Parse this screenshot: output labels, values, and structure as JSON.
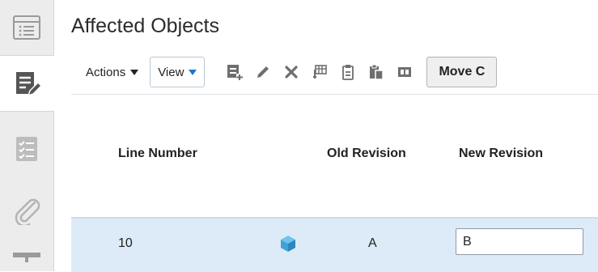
{
  "rail": {
    "items": [
      {
        "icon": "list-icon",
        "active": false
      },
      {
        "icon": "edit-document-icon",
        "active": true
      },
      {
        "icon": "checklist-icon",
        "active": false
      },
      {
        "icon": "paperclip-icon",
        "active": false
      },
      {
        "icon": "more-icon",
        "active": false
      }
    ]
  },
  "main": {
    "title": "Affected Objects",
    "toolbar": {
      "actions_label": "Actions",
      "view_label": "View",
      "icons": [
        "add-row-icon",
        "edit-pencil-icon",
        "delete-icon",
        "freeze-columns-icon",
        "copy-icon",
        "paste-icon",
        "detach-icon"
      ],
      "move_label": "Move C"
    },
    "table": {
      "columns": [
        "Line Number",
        "Old Revision",
        "New Revision"
      ],
      "rows": [
        {
          "line_number": "10",
          "item_icon": "item-cube-icon",
          "old_revision": "A",
          "new_revision": "B"
        }
      ]
    }
  },
  "colors": {
    "selected_row": "#dcebf7",
    "accent": "#1b78c9",
    "rail_background": "#ececec"
  }
}
